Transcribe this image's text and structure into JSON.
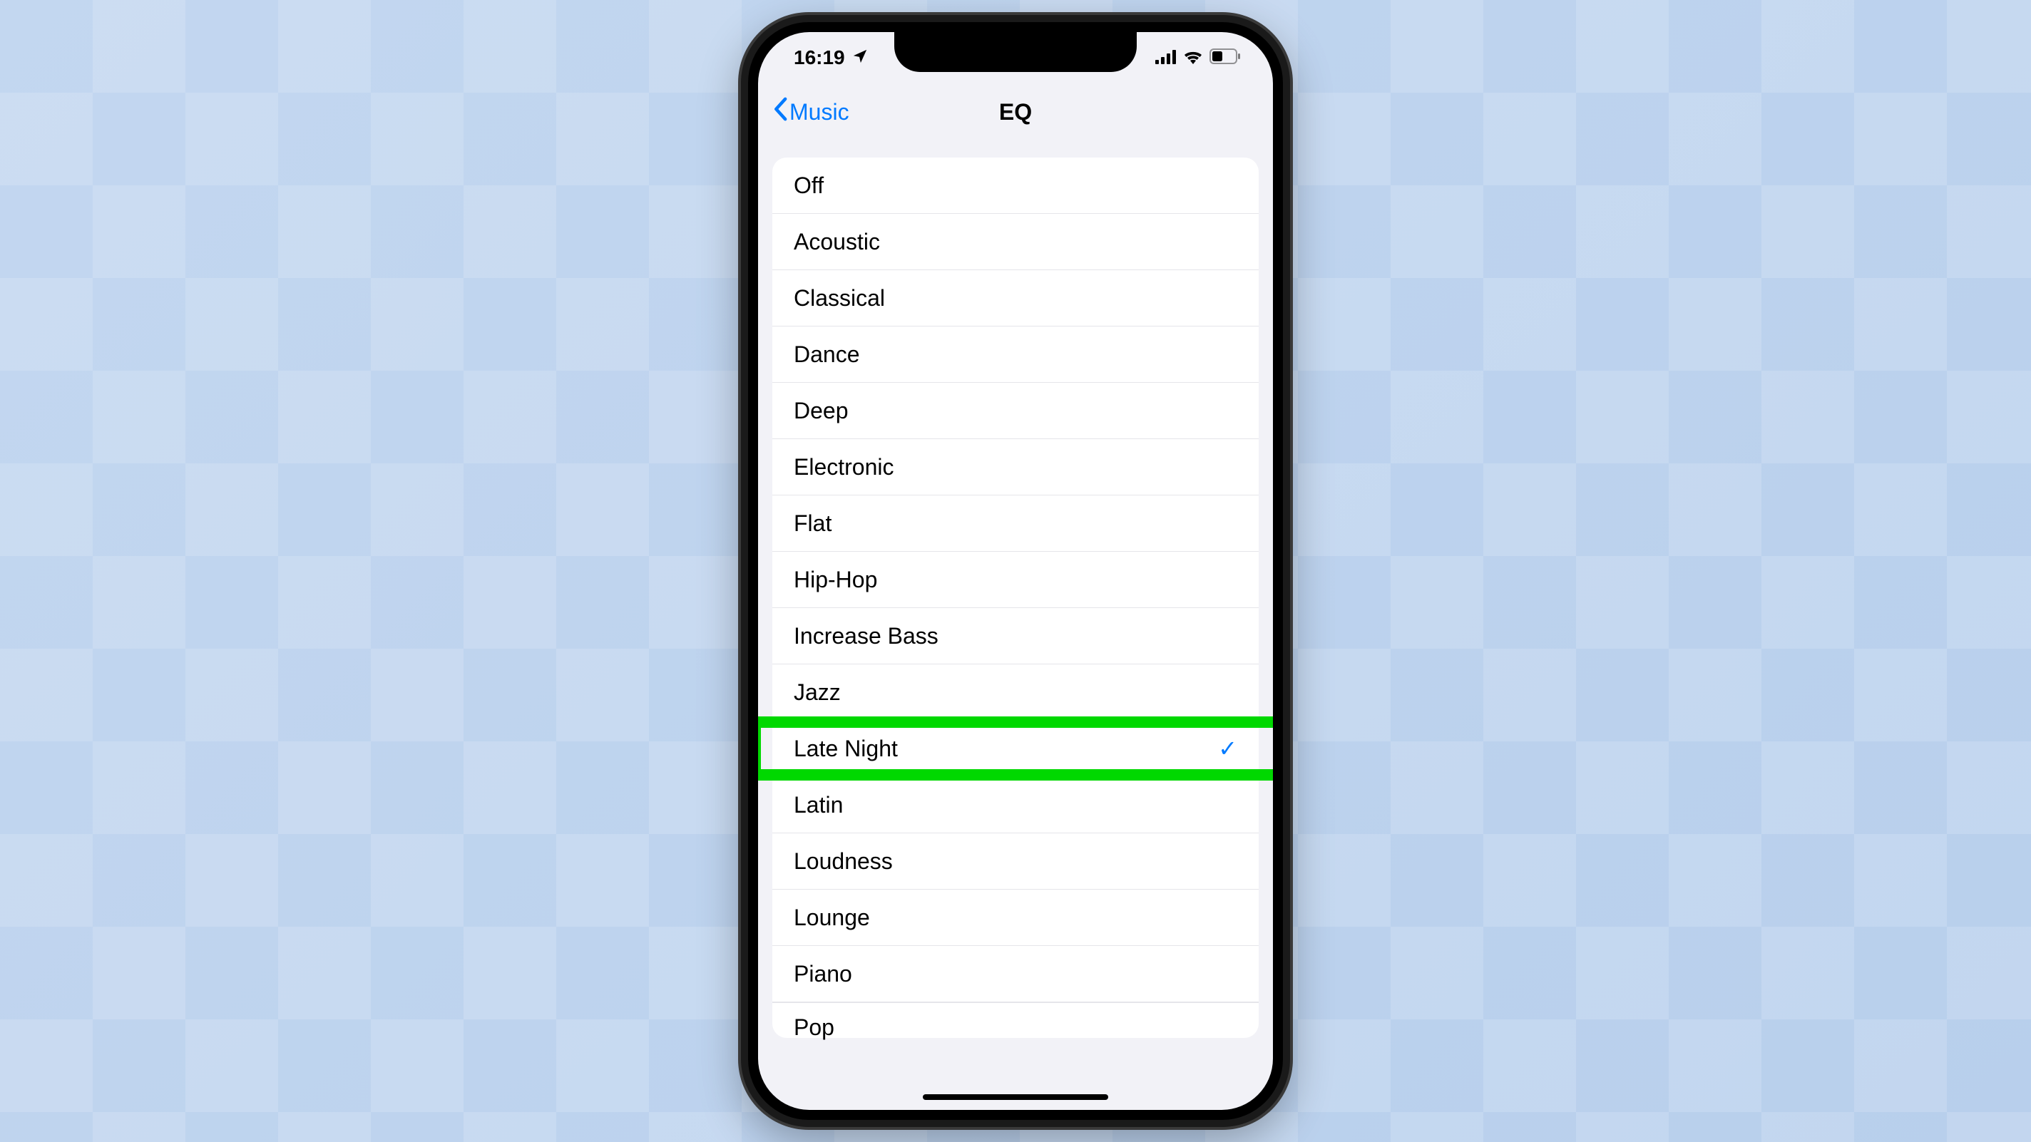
{
  "status_bar": {
    "time": "16:19"
  },
  "nav": {
    "back_label": "Music",
    "title": "EQ"
  },
  "eq_options": [
    {
      "label": "Off",
      "selected": false
    },
    {
      "label": "Acoustic",
      "selected": false
    },
    {
      "label": "Classical",
      "selected": false
    },
    {
      "label": "Dance",
      "selected": false
    },
    {
      "label": "Deep",
      "selected": false
    },
    {
      "label": "Electronic",
      "selected": false
    },
    {
      "label": "Flat",
      "selected": false
    },
    {
      "label": "Hip-Hop",
      "selected": false
    },
    {
      "label": "Increase Bass",
      "selected": false
    },
    {
      "label": "Jazz",
      "selected": false
    },
    {
      "label": "Late Night",
      "selected": true,
      "highlighted": true
    },
    {
      "label": "Latin",
      "selected": false
    },
    {
      "label": "Loudness",
      "selected": false
    },
    {
      "label": "Lounge",
      "selected": false
    },
    {
      "label": "Piano",
      "selected": false
    },
    {
      "label": "Pop",
      "selected": false
    }
  ],
  "colors": {
    "ios_blue": "#007aff",
    "highlight_green": "#00d800",
    "settings_bg": "#f2f2f7"
  }
}
